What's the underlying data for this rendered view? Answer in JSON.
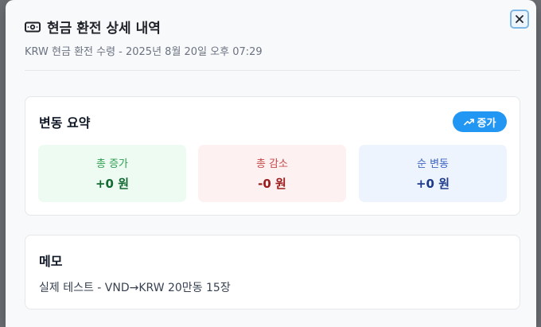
{
  "dialog": {
    "title": "현금 환전 상세 내역",
    "subtitle": "KRW 현금 환전 수령 - 2025년 8월 20일 오후 07:29",
    "close_icon": "close-icon",
    "title_icon": "cash-icon"
  },
  "summary": {
    "title": "변동 요약",
    "badge_label": "증가",
    "badge_icon": "trend-up-icon",
    "badge_color": "#2196f3",
    "stats": [
      {
        "label": "총 증가",
        "value": "+0 원",
        "color": "#136b33"
      },
      {
        "label": "총 감소",
        "value": "-0 원",
        "color": "#9b1c1c"
      },
      {
        "label": "순 변동",
        "value": "+0 원",
        "color": "#1e3a8a"
      }
    ]
  },
  "memo": {
    "title": "메모",
    "text": "실제 테스트 - VND→KRW 20만동 15장"
  }
}
